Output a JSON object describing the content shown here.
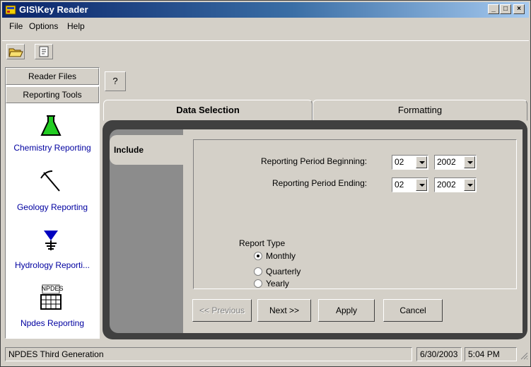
{
  "window": {
    "title": "GIS\\Key Reader",
    "controls": {
      "minimize": "_",
      "maximize": "□",
      "close": "×"
    }
  },
  "menu": [
    {
      "label": "File"
    },
    {
      "label": "Options"
    },
    {
      "label": "Help"
    }
  ],
  "toolbar": {
    "buttons": [
      {
        "icon": "open-folder-icon"
      },
      {
        "icon": "report-icon"
      }
    ]
  },
  "sidebar": {
    "tabs": [
      {
        "label": "Reader Files"
      },
      {
        "label": "Reporting Tools"
      }
    ],
    "items": [
      {
        "label": "Chemistry Reporting",
        "icon": "flask-icon"
      },
      {
        "label": "Geology Reporting",
        "icon": "pick-icon"
      },
      {
        "label": "Hydrology Reporti...",
        "icon": "water-level-icon"
      },
      {
        "label": "Npdes Reporting",
        "icon": "npdes-grid-icon",
        "badge": "NPDES"
      }
    ]
  },
  "help_button": "?",
  "tabs": [
    {
      "label": "Data Selection",
      "active": true
    },
    {
      "label": "Formatting",
      "active": false
    }
  ],
  "include_tab": "Include",
  "form": {
    "begin_label": "Reporting Period Beginning:",
    "begin_month": "02",
    "begin_year": "2002",
    "end_label": "Reporting Period Ending:",
    "end_month": "02",
    "end_year": "2002",
    "report_type_label": "Report Type",
    "report_types": [
      {
        "label": "Monthly",
        "checked": true
      },
      {
        "label": "Quarterly",
        "checked": false
      },
      {
        "label": "Yearly",
        "checked": false
      }
    ]
  },
  "buttons": {
    "previous": "<< Previous",
    "next": "Next >>",
    "apply": "Apply",
    "cancel": "Cancel"
  },
  "status": {
    "app": "NPDES Third Generation",
    "date": "6/30/2003",
    "time": "5:04 PM"
  },
  "colors": {
    "titlebar_start": "#0a246a",
    "titlebar_end": "#a6caf0",
    "face": "#d4d0c8",
    "link": "#0000a0",
    "flask": "#22cc22"
  }
}
